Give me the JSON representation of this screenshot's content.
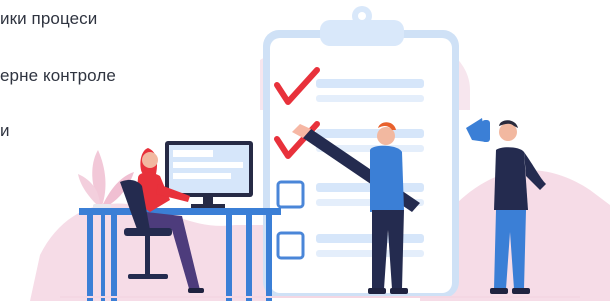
{
  "text": {
    "line1": "ики процеси",
    "line2": "ерне контроле",
    "line3": "и"
  },
  "colors": {
    "accent_red": "#e8313b",
    "blue": "#3b7fd6",
    "light_blue": "#dbe9fb",
    "soft_pink": "#f6dce7",
    "dark_navy": "#242b4f"
  },
  "illustration": {
    "checklist_items": [
      {
        "checked": true
      },
      {
        "checked": true
      },
      {
        "checked": false
      },
      {
        "checked": false
      },
      {
        "checked": false
      }
    ]
  }
}
